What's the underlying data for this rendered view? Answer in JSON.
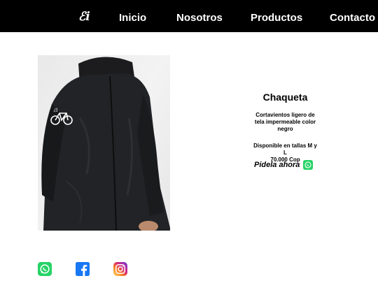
{
  "nav": {
    "logo": "ℰi",
    "links": [
      "Inicio",
      "Nosotros",
      "Productos",
      "Contacto"
    ]
  },
  "product": {
    "title": "Chaqueta",
    "description": "Cortavientos ligero de tela impermeable color negro",
    "availability": "Disponible en tallas M y L",
    "price": "70.000 Cop",
    "cta": "Pidela ahora",
    "cta_icon": "whatsapp-icon"
  },
  "social": [
    "whatsapp-icon",
    "facebook-icon",
    "instagram-icon"
  ],
  "colors": {
    "navbar": "#000000",
    "whatsapp": "#25d366",
    "facebook": "#1877f2"
  }
}
